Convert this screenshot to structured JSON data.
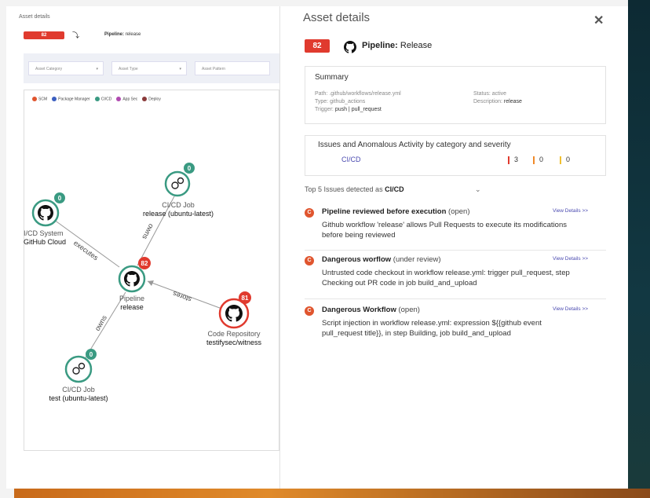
{
  "left": {
    "title": "Asset details",
    "badge": "82",
    "pipeline_label": "Pipeline:",
    "pipeline_value": "release",
    "filters": [
      {
        "placeholder": "Asset Category",
        "has_chevron": true
      },
      {
        "placeholder": "Asset Type",
        "has_chevron": true
      },
      {
        "placeholder": "Asset Pattern",
        "has_chevron": false
      }
    ],
    "legend": [
      {
        "label": "SCM",
        "color": "#e0552e"
      },
      {
        "label": "Package Manager",
        "color": "#3b5fc0"
      },
      {
        "label": "CI/CD",
        "color": "#3a9a82"
      },
      {
        "label": "App Sec",
        "color": "#b04ab0"
      },
      {
        "label": "Deploy",
        "color": "#8a3a3a"
      }
    ]
  },
  "graph": {
    "edges": {
      "executes": "executes",
      "owns_top": "owns",
      "owns_bottom": "owns",
      "stores": "stores"
    },
    "nodes": {
      "cicd_job_top": {
        "badge": "0",
        "line1": "CI/CD Job",
        "line2": "release (ubuntu-latest)"
      },
      "cicd_system": {
        "badge": "0",
        "line1": "I/CD System",
        "line2": "GitHub Cloud"
      },
      "pipeline": {
        "badge": "82",
        "line1": "Pipeline",
        "line2": "release"
      },
      "code_repo": {
        "badge": "81",
        "line1": "Code Repository",
        "line2": "testifysec/witness"
      },
      "cicd_job_bottom": {
        "badge": "0",
        "line1": "CI/CD Job",
        "line2": "test (ubuntu-latest)"
      }
    }
  },
  "right": {
    "title": "Asset details",
    "close": "✕",
    "badge": "82",
    "pipeline_label": "Pipeline:",
    "pipeline_value": "Release",
    "summary": {
      "heading": "Summary",
      "path_label": "Path:",
      "path_value": ".github/workflows/release.yml",
      "type_label": "Type:",
      "type_value": "github_actions",
      "trigger_label": "Trigger:",
      "trigger_value": "push | pull_request",
      "status_label": "Status:",
      "status_value": "active",
      "description_label": "Description:",
      "description_value": "release"
    },
    "issues_box": {
      "heading": "Issues and Anomalous Activity by category and severity",
      "category": "CI/CD",
      "high": "3",
      "medium": "0",
      "low": "0",
      "high_color": "#e03a2e",
      "medium_color": "#f08a2a",
      "low_color": "#f0c030"
    },
    "top5_prefix": "Top 5 Issues detected as",
    "top5_category": "CI/CD",
    "issues": [
      {
        "icon": "C",
        "title": "Pipeline reviewed before execution",
        "status": "(open)",
        "link": "View Details >>",
        "desc1": "Github workflow 'release' allows Pull Requests to execute its modifications",
        "desc2": "before being reviewed"
      },
      {
        "icon": "C",
        "title": "Dangerous worflow",
        "status": "(under review)",
        "link": "View Details >>",
        "desc1": "Untrusted code checkout in workflow release.yml: trigger pull_request, step",
        "desc2": "Checking out PR code in job build_and_upload"
      },
      {
        "icon": "C",
        "title": "Dangerous Workflow",
        "status": "(open)",
        "link": "View Details >>",
        "desc1": "Script injection in workflow release.yml: expression ${{github event",
        "desc2": "pull_request title}}, in step Building, job build_and_upload"
      }
    ]
  }
}
